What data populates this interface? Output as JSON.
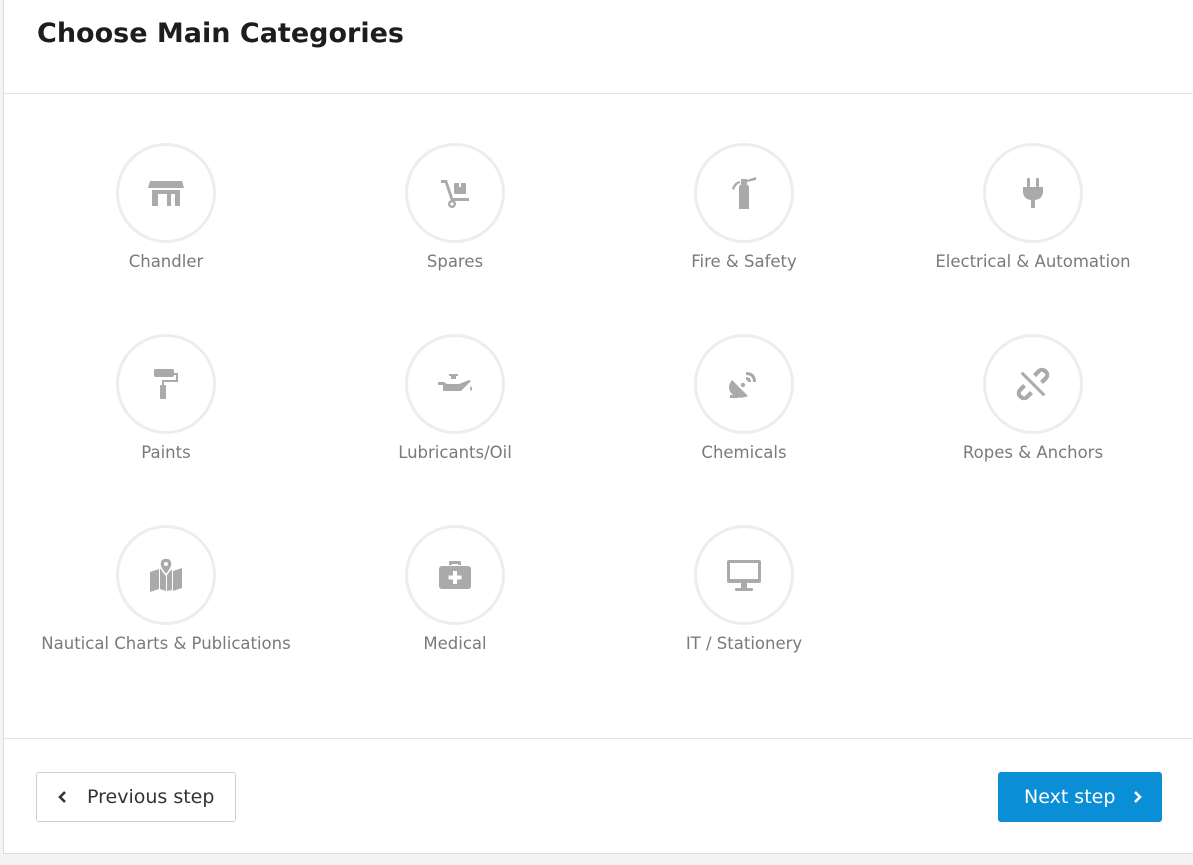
{
  "page": {
    "title": "Choose Main Categories"
  },
  "categories": [
    {
      "label": "Chandler",
      "icon": "store-icon"
    },
    {
      "label": "Spares",
      "icon": "dolly-icon"
    },
    {
      "label": "Fire & Safety",
      "icon": "fire-extinguisher-icon"
    },
    {
      "label": "Electrical & Automation",
      "icon": "plug-icon"
    },
    {
      "label": "Paints",
      "icon": "paint-roller-icon"
    },
    {
      "label": "Lubricants/Oil",
      "icon": "oil-can-icon"
    },
    {
      "label": "Chemicals",
      "icon": "satellite-dish-icon"
    },
    {
      "label": "Ropes & Anchors",
      "icon": "unlink-icon"
    },
    {
      "label": "Nautical Charts & Publications",
      "icon": "map-marked-icon"
    },
    {
      "label": "Medical",
      "icon": "medkit-icon"
    },
    {
      "label": "IT / Stationery",
      "icon": "desktop-icon"
    }
  ],
  "footer": {
    "prev_label": "Previous step",
    "next_label": "Next step"
  },
  "colors": {
    "accent": "#0a8ed6",
    "icon": "#aaaaaa",
    "label": "#7a7a7a"
  }
}
